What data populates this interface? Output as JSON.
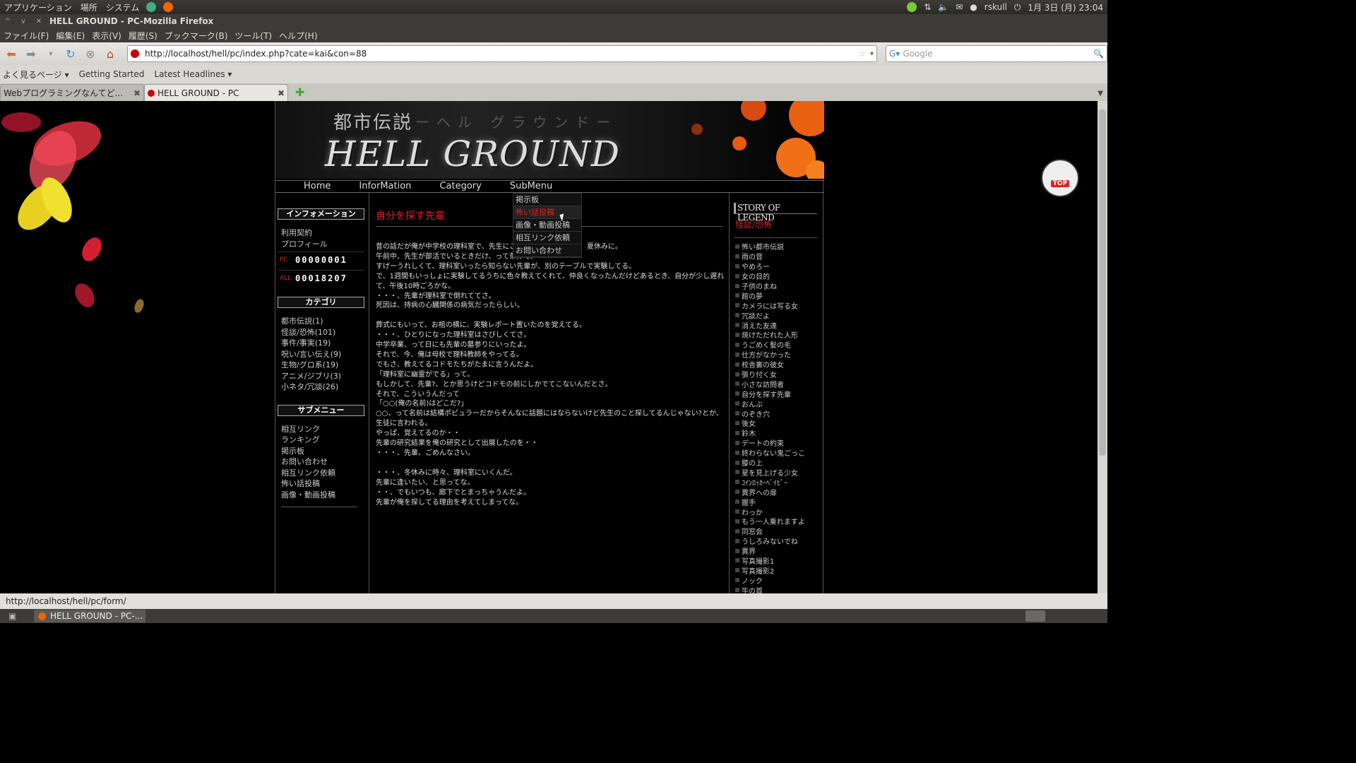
{
  "os": {
    "top_menu": [
      "アプリケーション",
      "場所",
      "システム"
    ],
    "user": "rskull",
    "datetime": "1月 3日 (月) 23:04"
  },
  "window": {
    "title": "HELL GROUND - PC-Mozilla Firefox"
  },
  "menubar": [
    "ファイル(F)",
    "編集(E)",
    "表示(V)",
    "履歴(S)",
    "ブックマーク(B)",
    "ツール(T)",
    "ヘルプ(H)"
  ],
  "navbar": {
    "url": "http://localhost/hell/pc/index.php?cate=kai&con=88",
    "search_placeholder": "Google"
  },
  "bookmarks": [
    "よく見るページ ▾",
    "Getting Started",
    "Latest Headlines ▾"
  ],
  "tabs": [
    {
      "label": "Webプログラミングなんてど..."
    },
    {
      "label": "HELL GROUND - PC"
    }
  ],
  "site": {
    "header": {
      "subtitle": "都市伝説",
      "subtitle_kana": "ーヘル グラウンドー",
      "title": "HELL GROUND"
    },
    "nav": [
      "Home",
      "InforMation",
      "Category",
      "SubMenu"
    ],
    "dropdown": [
      "掲示板",
      "怖い話投稿",
      "画像・動画投稿",
      "相互リンク依頼",
      "お問い合わせ"
    ],
    "left": {
      "info_title": "インフォメーション",
      "info_links": [
        "利用契約",
        "プロフィール"
      ],
      "counter_pc_label": "PC",
      "counter_pc": "00000001",
      "counter_all_label": "ALL",
      "counter_all": "00018207",
      "category_title": "カテゴリ",
      "categories": [
        "都市伝説(1)",
        "怪談/恐怖(101)",
        "事件/事実(19)",
        "呪い/言い伝え(9)",
        "生物/グロ系(19)",
        "アニメ/ジブリ(3)",
        "小ネタ/冗談(26)"
      ],
      "submenu_title": "サブメニュー",
      "submenu": [
        "相互リンク",
        "ランキング",
        "掲示板",
        "お問い合わせ",
        "相互リンク依頼",
        "怖い話投稿",
        "画像・動画投稿"
      ]
    },
    "main": {
      "title": "自分を探す先輩",
      "body": [
        "昔の話だが俺が中学校の理科室で、先生にことわって…たんだよ、夏休みに。",
        "午前中、先生が部活でいるときだけ、って条件で。",
        "すげーうれしくて、理科室いったら知らない先輩が、別のテーブルで実験してる。",
        "で、1週間もいっしょに実験してるうちに色々教えてくれて、仲良くなったんだけどあるとき、自分が少し遅れて、午後10時ごろかな。",
        "・・・、先輩が理科室で倒れててさ。",
        "死因は、持病の心臓関係の病気だったらしい。",
        "",
        "葬式にもいって、お棺の横に、実験レポート置いたのを覚えてる。",
        "・・・、ひとりになった理科室はさびしくてさ。",
        "中学卒業、って日にも先輩の墓参りにいったよ。",
        "それで、今、俺は母校で理科教師をやってる。",
        "でもさ、教えてるコドモたちがたまに言うんだよ。",
        "「理科室に幽霊がでる」って。",
        "もしかして、先輩?、とか思うけどコドモの前にしかでてこないんだとさ。",
        "それで、こういうんだって",
        "「○○(俺の名前)はどこだ?」",
        "○○、って名前は結構ポピュラーだからそんなに話題にはならないけど先生のこと探してるんじゃない?とか、生徒に言われる。",
        "やっぱ、覚えてるのか・・",
        "先輩の研究結果を俺の研究として出展したのを・・",
        "・・・、先輩、ごめんなさい。",
        "",
        "・・・、冬休みに時々、理科室にいくんだ。",
        "先輩に逢いたい、と思ってな。",
        "・・、でもいつも、廊下でとまっちゃうんだよ。",
        "先輩が俺を探してる理由を考えてしまってな。"
      ]
    },
    "right": {
      "title": "STORY OF LEGEND",
      "category": "怪談/恐怖",
      "stories": [
        "怖い都市伝説",
        "雨の音",
        "やめろー",
        "女の目的",
        "子供のまね",
        "館の夢",
        "カメラには写る女",
        "冗談だよ",
        "消えた友達",
        "焼けただれた人形",
        "うごめく髪の毛",
        "仕方がなかった",
        "校舎裏の彼女",
        "張り付く女",
        "小さな訪問者",
        "自分を探す先輩",
        "おんぶ",
        "のぞき穴",
        "後女",
        "鈴木",
        "デートの約束",
        "終わらない鬼ごっこ",
        "膝の上",
        "星を見上げる少女",
        "ｺｲﾝﾛｯｶｰﾍﾞｲﾋﾞｰ",
        "異界への扉",
        "握手",
        "わっか",
        "もう一人乗れますよ",
        "同窓会",
        "うしろみないでね",
        "異界",
        "写真撮影1",
        "写真撮影2",
        "ノック",
        "牛の首"
      ]
    },
    "top_button": "TOP"
  },
  "statusbar": "http://localhost/hell/pc/form/",
  "taskbar": {
    "item": "HELL GROUND - PC-..."
  }
}
